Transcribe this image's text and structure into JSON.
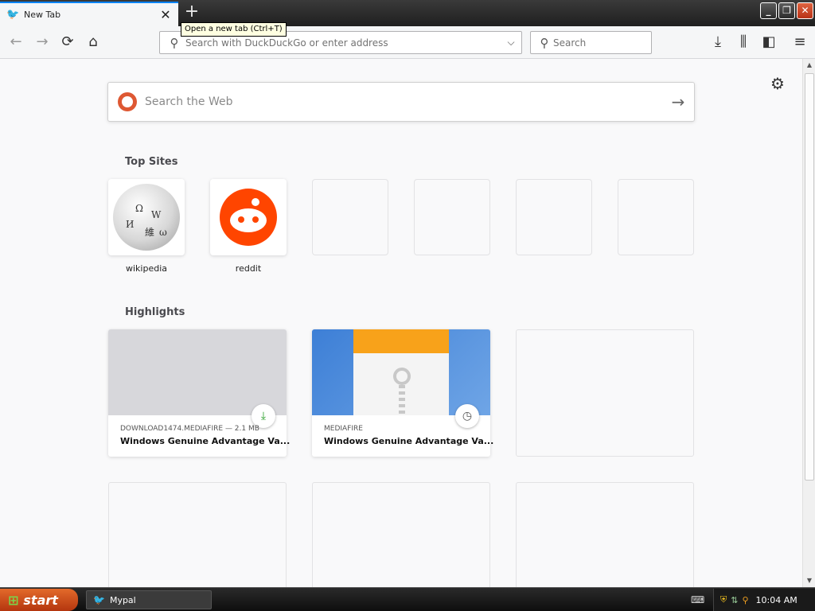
{
  "browser": {
    "tab": {
      "title": "New Tab",
      "favicon": "mypal-bird-icon",
      "close_label": "✕"
    },
    "newtab_symbol": "+",
    "tooltip": "Open a new tab (Ctrl+T)",
    "window_buttons": {
      "minimize": "_",
      "maximize": "❐",
      "close": "✕"
    },
    "nav": {
      "back": "←",
      "forward": "→",
      "reload": "⟳",
      "home": "⌂"
    },
    "urlbar": {
      "placeholder": "Search with DuckDuckGo or enter address",
      "value": ""
    },
    "searchbar": {
      "placeholder": "Search"
    },
    "toolbar_icons": {
      "download": "⤓",
      "library": "⫼",
      "sidebar": "◧",
      "menu": "≡"
    }
  },
  "newtab": {
    "websearch": {
      "placeholder": "Search the Web",
      "go": "→"
    },
    "top_sites_title": "Top Sites",
    "top_sites": [
      {
        "label": "wikipedia",
        "icon": "wikipedia-globe-icon"
      },
      {
        "label": "reddit",
        "icon": "reddit-alien-icon"
      },
      {
        "label": ""
      },
      {
        "label": ""
      },
      {
        "label": ""
      },
      {
        "label": ""
      }
    ],
    "highlights_title": "Highlights",
    "highlights": [
      {
        "source": "DOWNLOAD1474.MEDIAFIRE — 2.1 MB",
        "title": "Windows Genuine Advantage Va...",
        "badge": "download-icon"
      },
      {
        "source": "MEDIAFIRE",
        "title": "Windows Genuine Advantage Va...",
        "badge": "clock-icon"
      }
    ]
  },
  "taskbar": {
    "start_label": "start",
    "task_label": "Mypal",
    "clock": "10:04 AM"
  },
  "colors": {
    "accent": "#0a84ff",
    "reddit": "#ff4500",
    "ddg": "#de5833",
    "download_green": "#2ca02c",
    "start_orange": "#d9531e"
  }
}
